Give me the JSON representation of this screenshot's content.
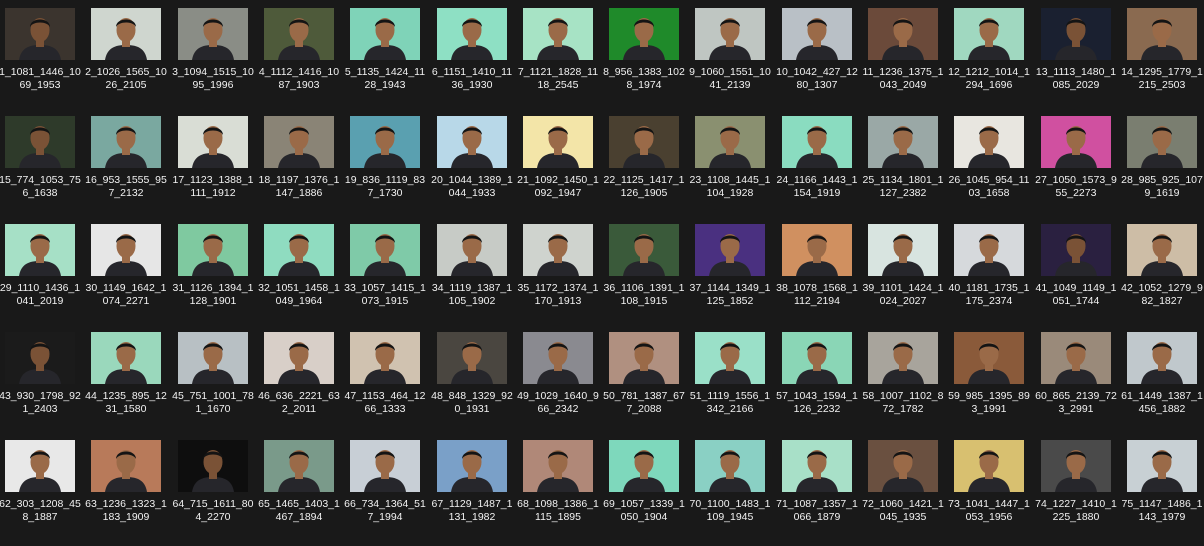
{
  "window": {
    "view": "Large icons",
    "background": "#191919"
  },
  "files": [
    {
      "name": "1_1081_1446_1069_1953",
      "bg": "#3b342e"
    },
    {
      "name": "2_1026_1565_1026_2105",
      "bg": "#cfd6cf"
    },
    {
      "name": "3_1094_1515_1095_1996",
      "bg": "#8a8d86"
    },
    {
      "name": "4_1112_1416_1087_1903",
      "bg": "#4e5a3a"
    },
    {
      "name": "5_1135_1424_1128_1943",
      "bg": "#7fd3b8"
    },
    {
      "name": "6_1151_1410_1136_1930",
      "bg": "#8ee0c4"
    },
    {
      "name": "7_1121_1828_1118_2545",
      "bg": "#a7e3c5"
    },
    {
      "name": "8_956_1383_1028_1974",
      "bg": "#1f8a2a"
    },
    {
      "name": "9_1060_1551_1041_2139",
      "bg": "#bfc6c2"
    },
    {
      "name": "10_1042_427_1280_1307",
      "bg": "#b9c0c6"
    },
    {
      "name": "11_1236_1375_1043_2049",
      "bg": "#6b4a3a"
    },
    {
      "name": "12_1212_1014_1294_1696",
      "bg": "#a0d8c0"
    },
    {
      "name": "13_1113_1480_1085_2029",
      "bg": "#1a2030"
    },
    {
      "name": "14_1295_1779_1215_2503",
      "bg": "#8a6a50"
    },
    {
      "name": "15_774_1053_756_1638",
      "bg": "#2e3a2a"
    },
    {
      "name": "16_953_1555_957_2132",
      "bg": "#7aa8a0"
    },
    {
      "name": "17_1123_1388_1111_1912",
      "bg": "#d9ddd5"
    },
    {
      "name": "18_1197_1376_1147_1886",
      "bg": "#8a8476"
    },
    {
      "name": "19_836_1119_837_1730",
      "bg": "#5aa0b0"
    },
    {
      "name": "20_1044_1389_1044_1933",
      "bg": "#b8d8e8"
    },
    {
      "name": "21_1092_1450_1092_1947",
      "bg": "#f3e5a8"
    },
    {
      "name": "22_1125_1417_1126_1905",
      "bg": "#4a4030"
    },
    {
      "name": "23_1108_1445_1104_1928",
      "bg": "#8a9070"
    },
    {
      "name": "24_1166_1443_1154_1919",
      "bg": "#8adcc0"
    },
    {
      "name": "25_1134_1801_1127_2382",
      "bg": "#9aa8a6"
    },
    {
      "name": "26_1045_954_1103_1658",
      "bg": "#e8e6e0"
    },
    {
      "name": "27_1050_1573_955_2273",
      "bg": "#d050a0"
    },
    {
      "name": "28_985_925_1079_1619",
      "bg": "#7a7e70"
    },
    {
      "name": "29_1110_1436_1041_2019",
      "bg": "#a6e0c6"
    },
    {
      "name": "30_1149_1642_1074_2271",
      "bg": "#e6e6e6"
    },
    {
      "name": "31_1126_1394_1128_1901",
      "bg": "#7fc9a0"
    },
    {
      "name": "32_1051_1458_1049_1964",
      "bg": "#8fdcc0"
    },
    {
      "name": "33_1057_1415_1073_1915",
      "bg": "#7fcaa8"
    },
    {
      "name": "34_1119_1387_1105_1902",
      "bg": "#c7cbc6"
    },
    {
      "name": "35_1172_1374_1170_1913",
      "bg": "#cfd3ce"
    },
    {
      "name": "36_1106_1391_1108_1915",
      "bg": "#3a5a3a"
    },
    {
      "name": "37_1144_1349_1125_1852",
      "bg": "#4a3080"
    },
    {
      "name": "38_1078_1568_1112_2194",
      "bg": "#d09060"
    },
    {
      "name": "39_1101_1424_1024_2027",
      "bg": "#d8e4e0"
    },
    {
      "name": "40_1181_1735_1175_2374",
      "bg": "#d6d9dc"
    },
    {
      "name": "41_1049_1149_1051_1744",
      "bg": "#2a2040"
    },
    {
      "name": "42_1052_1279_982_1827",
      "bg": "#cdbda6"
    },
    {
      "name": "43_930_1798_921_2403",
      "bg": "#1b1b1b"
    },
    {
      "name": "44_1235_895_1231_1580",
      "bg": "#9ad8bc"
    },
    {
      "name": "45_751_1001_781_1670",
      "bg": "#b8c0c4"
    },
    {
      "name": "46_636_2221_632_2011",
      "bg": "#d8cfc8"
    },
    {
      "name": "47_1153_464_1266_1333",
      "bg": "#d0c2b0"
    },
    {
      "name": "48_848_1329_920_1931",
      "bg": "#4a4640"
    },
    {
      "name": "49_1029_1640_966_2342",
      "bg": "#8a8a90"
    },
    {
      "name": "50_781_1387_677_2088",
      "bg": "#b09080"
    },
    {
      "name": "51_1119_1556_1342_2166",
      "bg": "#9ae0c8"
    },
    {
      "name": "57_1043_1594_1126_2232",
      "bg": "#8ad6b6"
    },
    {
      "name": "58_1007_1102_872_1782",
      "bg": "#a8a49c"
    },
    {
      "name": "59_985_1395_893_1991",
      "bg": "#8a5a3a"
    },
    {
      "name": "60_865_2139_723_2991",
      "bg": "#9a8a7a"
    },
    {
      "name": "61_1449_1387_1456_1882",
      "bg": "#c0c8cc"
    },
    {
      "name": "62_303_1208_458_1887",
      "bg": "#e8e8e8"
    },
    {
      "name": "63_1236_1323_1183_1909",
      "bg": "#b87a5a"
    },
    {
      "name": "64_715_1611_804_2270",
      "bg": "#0e0e0e"
    },
    {
      "name": "65_1465_1403_1467_1894",
      "bg": "#7a9a8a"
    },
    {
      "name": "66_734_1364_517_1994",
      "bg": "#c8cfd6"
    },
    {
      "name": "67_1129_1487_1131_1982",
      "bg": "#7aa0c8"
    },
    {
      "name": "68_1098_1386_1115_1895",
      "bg": "#b08878"
    },
    {
      "name": "69_1057_1339_1050_1904",
      "bg": "#7ed8bc"
    },
    {
      "name": "70_1100_1483_1109_1945",
      "bg": "#8ad0c4"
    },
    {
      "name": "71_1087_1357_1066_1879",
      "bg": "#a8e0c8"
    },
    {
      "name": "72_1060_1421_1045_1935",
      "bg": "#6a5040"
    },
    {
      "name": "73_1041_1447_1053_1956",
      "bg": "#d8c070"
    },
    {
      "name": "74_1227_1410_1225_1880",
      "bg": "#4a4a4a"
    },
    {
      "name": "75_1147_1486_1143_1979",
      "bg": "#c8d0d4"
    }
  ]
}
